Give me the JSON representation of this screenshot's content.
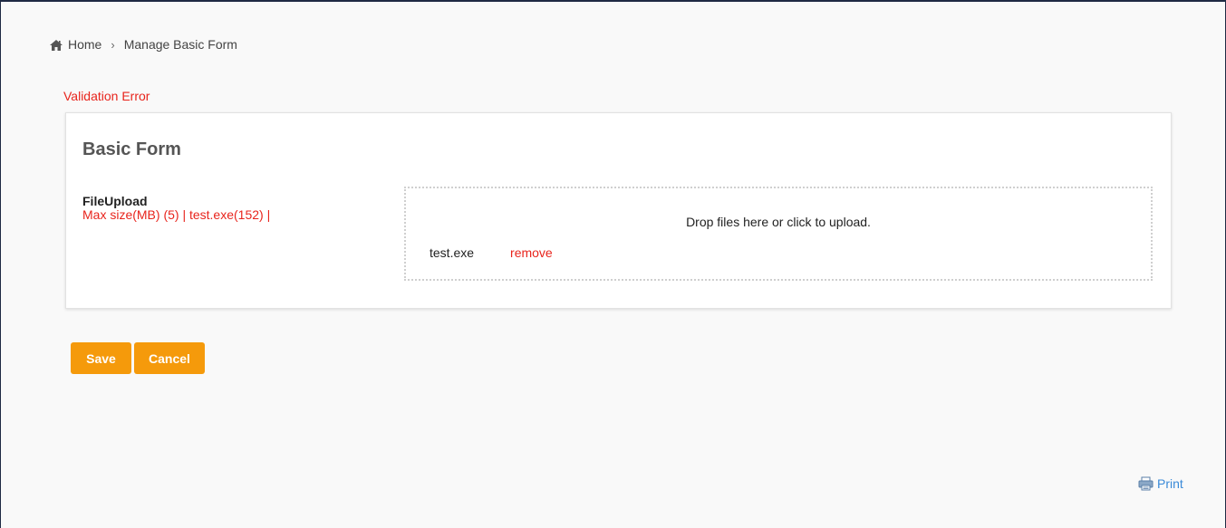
{
  "breadcrumb": {
    "home_icon": "home-icon",
    "home_label": "Home",
    "separator": "›",
    "current": "Manage Basic Form"
  },
  "validation": {
    "message": "Validation Error",
    "color": "#e8241c"
  },
  "form": {
    "title": "Basic Form",
    "fields": [
      {
        "label": "FileUpload",
        "hint": "Max size(MB) (5) | test.exe(152) |",
        "dropzone": {
          "message": "Drop files here or click to upload.",
          "files": [
            {
              "name": "test.exe",
              "remove_label": "remove"
            }
          ]
        }
      }
    ]
  },
  "actions": {
    "save_label": "Save",
    "cancel_label": "Cancel",
    "button_color": "#f59a0b"
  },
  "footer": {
    "print_icon": "print-icon",
    "print_label": "Print",
    "link_color": "#3a8ad8"
  }
}
